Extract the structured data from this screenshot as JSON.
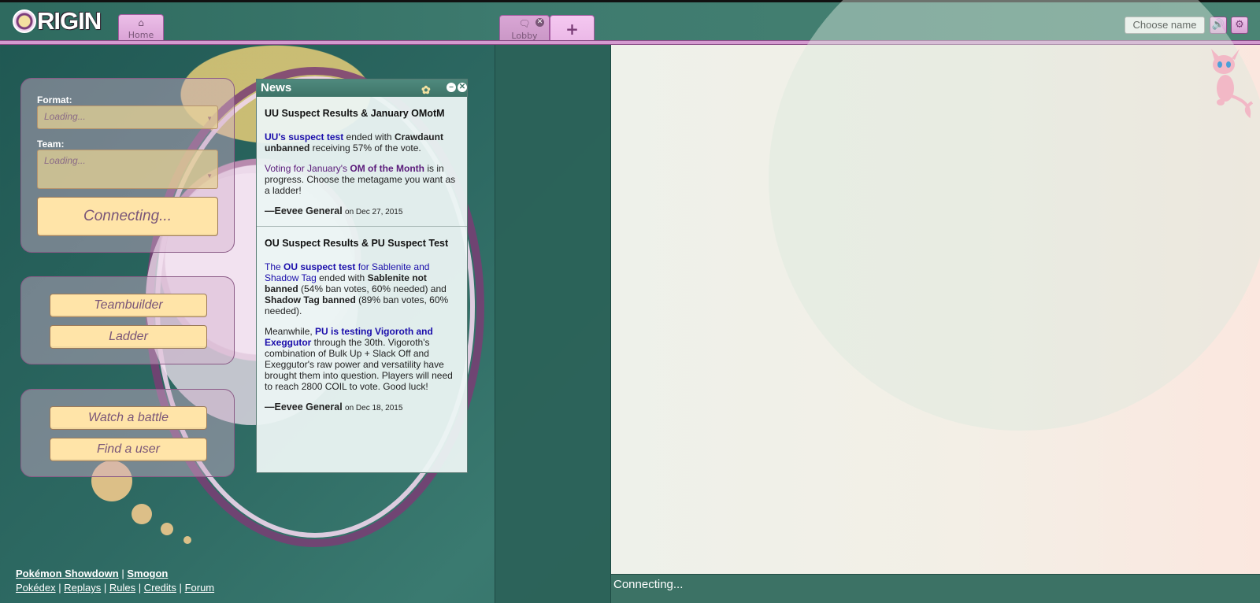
{
  "header": {
    "logo_text": "RIGIN",
    "tabs": [
      {
        "id": "home",
        "label": "Home",
        "icon": "home-icon"
      },
      {
        "id": "lobby",
        "label": "Lobby",
        "icon": "chat-bubble-icon"
      },
      {
        "id": "new",
        "label": "+",
        "icon": "plus-icon"
      }
    ],
    "choose_name_label": "Choose name"
  },
  "sidebar": {
    "format_label": "Format:",
    "format_value": "Loading...",
    "team_label": "Team:",
    "team_value": "Loading...",
    "connecting_label": "Connecting...",
    "teambuilder_label": "Teambuilder",
    "ladder_label": "Ladder",
    "watch_label": "Watch a battle",
    "find_user_label": "Find a user"
  },
  "footer": {
    "line1": [
      "Pokémon Showdown",
      "Smogon"
    ],
    "line2": [
      "Pokédex",
      "Replays",
      "Rules",
      "Credits",
      "Forum"
    ],
    "separator": "|"
  },
  "news": {
    "title": "News",
    "items": [
      {
        "heading": "UU Suspect Results & January OMotM",
        "p1_link": "UU's suspect test",
        "p1_text1": " ended with ",
        "p1_bold": "Crawdaunt unbanned",
        "p1_text2": " receiving 57% of the vote.",
        "p2_link1": "Voting for January's ",
        "p2_link1b": "OM of the Month",
        "p2_text": " is in progress. Choose the metagame you want as a ladder!",
        "author": "—Eevee General",
        "date": "on Dec 27, 2015"
      },
      {
        "heading": "OU Suspect Results & PU Suspect Test",
        "p1_linka": "The ",
        "p1_linkb": "OU suspect test",
        "p1_linkc": " for Sablenite and Shadow Tag",
        "p1_text1": " ended with ",
        "p1_bold1": "Sablenite not banned",
        "p1_text2": " (54% ban votes, 60% needed) and ",
        "p1_bold2": "Shadow Tag banned",
        "p1_text3": " (89% ban votes, 60% needed).",
        "p2_text1": "Meanwhile, ",
        "p2_link": "PU is testing Vigoroth and Exeggutor",
        "p2_text2": " through the 30th. Vigoroth's combination of Bulk Up + Slack Off and Exeggutor's raw power and versatility have brought them into question. Players will need to reach 2800 COIL to vote. Good luck!",
        "author": "—Eevee General",
        "date": "on Dec 18, 2015"
      }
    ]
  },
  "room": {
    "status_text": "Connecting..."
  },
  "colors": {
    "header_teal": "#3d7a6e",
    "tab_pink": "#d8a0d4",
    "button_cream": "#ffe4a8",
    "room_bg": "#f3efe6"
  }
}
